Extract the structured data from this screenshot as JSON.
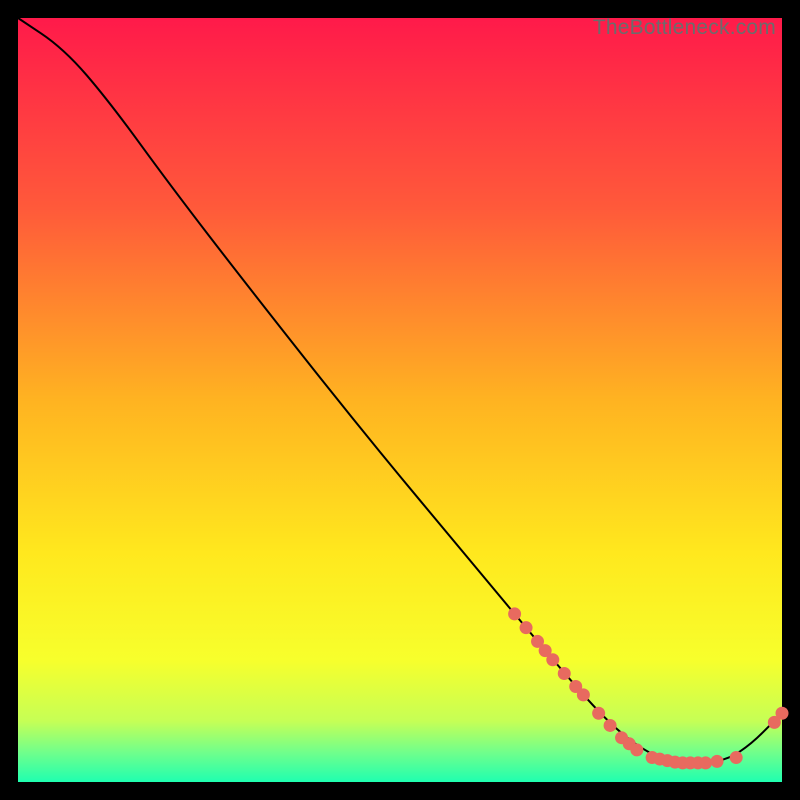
{
  "watermark": "TheBottleneck.com",
  "chart_data": {
    "type": "line",
    "title": "",
    "xlabel": "",
    "ylabel": "",
    "xlim": [
      0,
      100
    ],
    "ylim": [
      0,
      100
    ],
    "gradient_stops": [
      {
        "offset": 0.0,
        "color": "#ff1a4a"
      },
      {
        "offset": 0.25,
        "color": "#ff5a3a"
      },
      {
        "offset": 0.5,
        "color": "#ffb321"
      },
      {
        "offset": 0.7,
        "color": "#ffe81e"
      },
      {
        "offset": 0.84,
        "color": "#f7ff2c"
      },
      {
        "offset": 0.92,
        "color": "#c6ff55"
      },
      {
        "offset": 0.96,
        "color": "#73ff8a"
      },
      {
        "offset": 1.0,
        "color": "#1fffb0"
      }
    ],
    "curve": [
      {
        "x": 0,
        "y": 100
      },
      {
        "x": 6,
        "y": 96
      },
      {
        "x": 12,
        "y": 89
      },
      {
        "x": 20,
        "y": 78
      },
      {
        "x": 30,
        "y": 65
      },
      {
        "x": 45,
        "y": 46
      },
      {
        "x": 60,
        "y": 28
      },
      {
        "x": 70,
        "y": 16
      },
      {
        "x": 77,
        "y": 8
      },
      {
        "x": 82,
        "y": 4
      },
      {
        "x": 86,
        "y": 2.5
      },
      {
        "x": 90,
        "y": 2.5
      },
      {
        "x": 93,
        "y": 3
      },
      {
        "x": 96,
        "y": 5
      },
      {
        "x": 99,
        "y": 8
      },
      {
        "x": 100,
        "y": 9
      }
    ],
    "markers": [
      {
        "x": 65,
        "y": 22
      },
      {
        "x": 66.5,
        "y": 20.2
      },
      {
        "x": 68,
        "y": 18.4
      },
      {
        "x": 69,
        "y": 17.2
      },
      {
        "x": 70,
        "y": 16
      },
      {
        "x": 71.5,
        "y": 14.2
      },
      {
        "x": 73,
        "y": 12.5
      },
      {
        "x": 74,
        "y": 11.4
      },
      {
        "x": 76,
        "y": 9
      },
      {
        "x": 77.5,
        "y": 7.4
      },
      {
        "x": 79,
        "y": 5.8
      },
      {
        "x": 80,
        "y": 5
      },
      {
        "x": 81,
        "y": 4.2
      },
      {
        "x": 83,
        "y": 3.2
      },
      {
        "x": 84,
        "y": 3
      },
      {
        "x": 85,
        "y": 2.8
      },
      {
        "x": 86,
        "y": 2.6
      },
      {
        "x": 87,
        "y": 2.5
      },
      {
        "x": 88,
        "y": 2.5
      },
      {
        "x": 89,
        "y": 2.5
      },
      {
        "x": 90,
        "y": 2.5
      },
      {
        "x": 91.5,
        "y": 2.7
      },
      {
        "x": 94,
        "y": 3.2
      },
      {
        "x": 99,
        "y": 7.8
      },
      {
        "x": 100,
        "y": 9
      }
    ],
    "marker_color": "#e86a5f",
    "curve_color": "#000000"
  }
}
